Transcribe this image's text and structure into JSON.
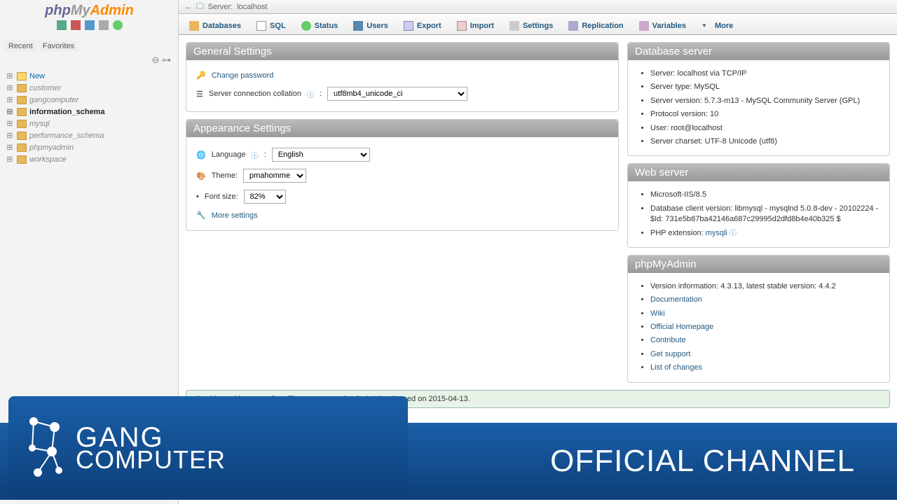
{
  "logo": {
    "php": "php",
    "my": "My",
    "admin": "Admin"
  },
  "sidebar": {
    "recent": "Recent",
    "favorites": "Favorites",
    "new_label": "New",
    "databases": [
      {
        "name": "customer"
      },
      {
        "name": "gangcomputer"
      },
      {
        "name": "information_schema",
        "active": true
      },
      {
        "name": "mysql"
      },
      {
        "name": "performance_schema"
      },
      {
        "name": "phpmyadmin"
      },
      {
        "name": "workspace"
      }
    ]
  },
  "server_bar": {
    "label": "Server:",
    "value": "localhost"
  },
  "tabs": [
    {
      "label": "Databases",
      "icon": "i-db"
    },
    {
      "label": "SQL",
      "icon": "i-sql"
    },
    {
      "label": "Status",
      "icon": "i-status"
    },
    {
      "label": "Users",
      "icon": "i-users"
    },
    {
      "label": "Export",
      "icon": "i-export"
    },
    {
      "label": "Import",
      "icon": "i-import"
    },
    {
      "label": "Settings",
      "icon": "i-settings"
    },
    {
      "label": "Replication",
      "icon": "i-repl"
    },
    {
      "label": "Variables",
      "icon": "i-vars"
    },
    {
      "label": "More",
      "icon": "i-more"
    }
  ],
  "general": {
    "title": "General Settings",
    "change_password": "Change password",
    "collation_label": "Server connection collation",
    "collation_value": "utf8mb4_unicode_ci"
  },
  "appearance": {
    "title": "Appearance Settings",
    "language_label": "Language",
    "language_value": "English",
    "theme_label": "Theme:",
    "theme_value": "pmahomme",
    "fontsize_label": "Font size:",
    "fontsize_value": "82%",
    "more_settings": "More settings"
  },
  "db_server": {
    "title": "Database server",
    "items": [
      "Server: localhost via TCP/IP",
      "Server type: MySQL",
      "Server version: 5.7.3-m13 - MySQL Community Server (GPL)",
      "Protocol version: 10",
      "User: root@localhost",
      "Server charset: UTF-8 Unicode (utf8)"
    ]
  },
  "web_server": {
    "title": "Web server",
    "item1": "Microsoft-IIS/8.5",
    "item2": "Database client version: libmysql - mysqlnd 5.0.8-dev - 20102224 - $Id: 731e5b87ba42146a687c29995d2dfd8b4e40b325 $",
    "item3_label": "PHP extension:",
    "item3_value": "mysqli"
  },
  "pma": {
    "title": "phpMyAdmin",
    "version": "Version information: 4.3.13, latest stable version: 4.4.2",
    "links": [
      "Documentation",
      "Wiki",
      "Official Homepage",
      "Contribute",
      "Get support",
      "List of changes"
    ]
  },
  "alert": "should consider upgrading. The newest version is 4.4.2, released on 2015-04-13.",
  "overlay": {
    "brand_top": "GANG",
    "brand_bot": "COMPUTER",
    "official": "OFFICIAL CHANNEL"
  }
}
